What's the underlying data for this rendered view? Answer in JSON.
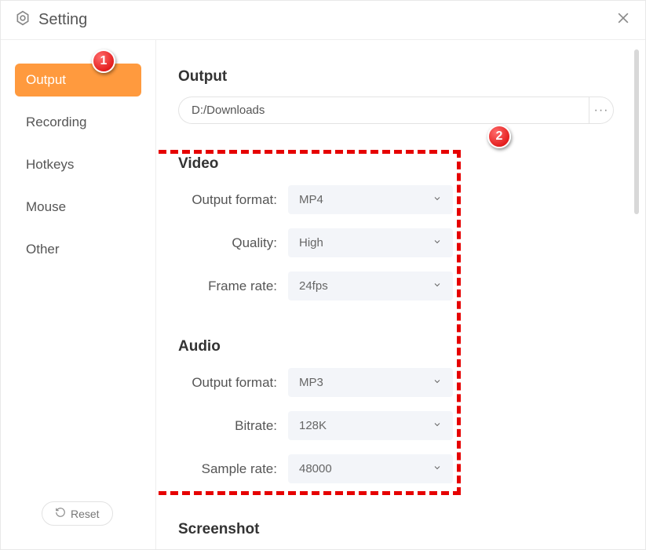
{
  "header": {
    "title": "Setting"
  },
  "sidebar": {
    "items": [
      {
        "label": "Output",
        "active": true
      },
      {
        "label": "Recording",
        "active": false
      },
      {
        "label": "Hotkeys",
        "active": false
      },
      {
        "label": "Mouse",
        "active": false
      },
      {
        "label": "Other",
        "active": false
      }
    ],
    "reset_label": "Reset"
  },
  "main": {
    "output": {
      "title": "Output",
      "path_value": "D:/Downloads"
    },
    "video": {
      "title": "Video",
      "rows": [
        {
          "label": "Output format:",
          "value": "MP4"
        },
        {
          "label": "Quality:",
          "value": "High"
        },
        {
          "label": "Frame rate:",
          "value": "24fps"
        }
      ]
    },
    "audio": {
      "title": "Audio",
      "rows": [
        {
          "label": "Output format:",
          "value": "MP3"
        },
        {
          "label": "Bitrate:",
          "value": "128K"
        },
        {
          "label": "Sample rate:",
          "value": "48000"
        }
      ]
    },
    "screenshot": {
      "title": "Screenshot"
    }
  },
  "annotations": {
    "callout1": "1",
    "callout2": "2"
  }
}
